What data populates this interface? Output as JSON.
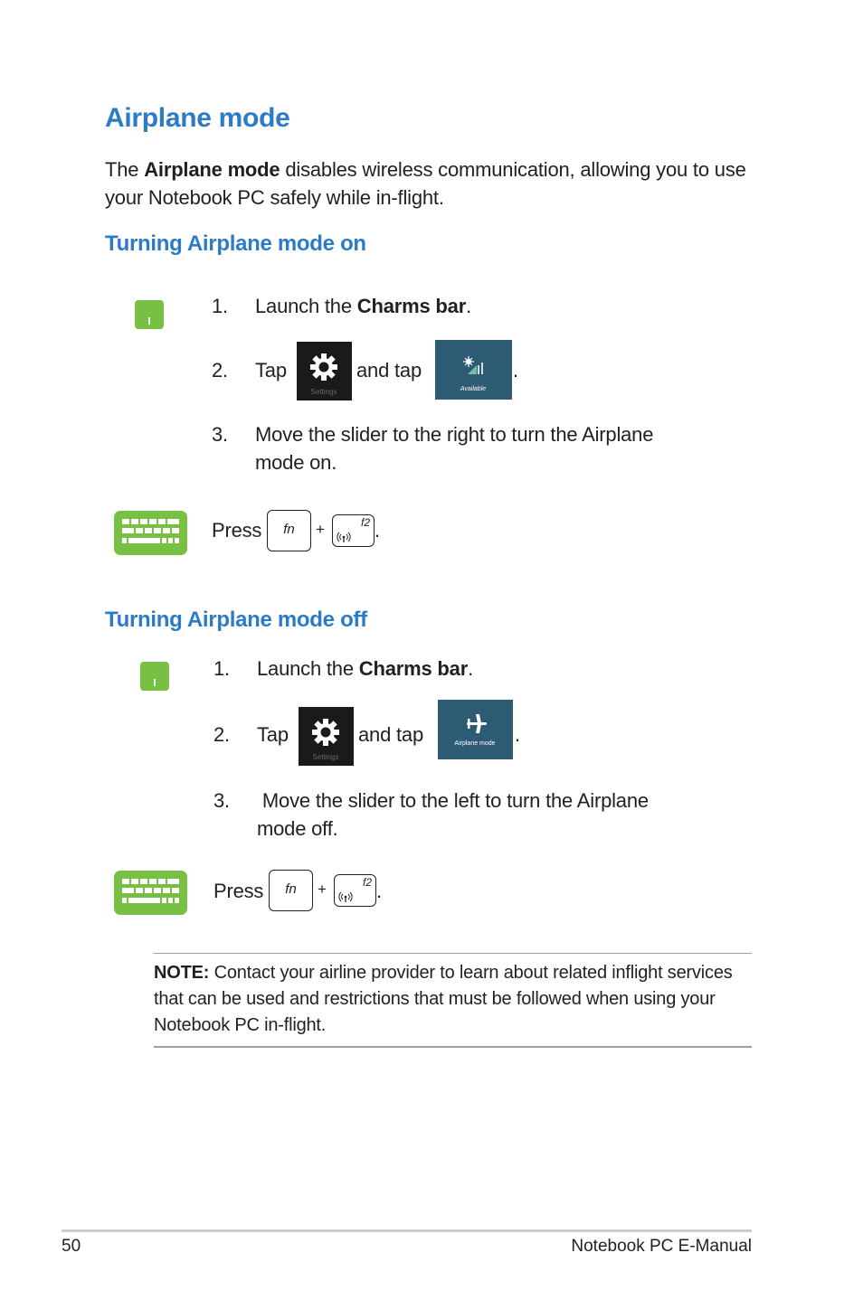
{
  "page": {
    "title": "Airplane mode",
    "intro": {
      "before": "The ",
      "bold": "Airplane mode",
      "after": " disables wireless communication, allowing you to use your Notebook PC safely while in-flight."
    }
  },
  "sections": [
    {
      "heading": "Turning Airplane mode on",
      "touch_steps": [
        {
          "num": "1.",
          "before": "Launch the ",
          "bold": "Charms bar",
          "after": "."
        },
        {
          "num": "2.",
          "tap": "Tap",
          "and_tap": "and tap",
          "end": ".",
          "tile1_label": "Settings",
          "tile1_icon": "gear-icon",
          "tile2_label": "Available",
          "tile2_icon": "wifi-signal-icon"
        },
        {
          "num": "3.",
          "text_line1": "Move the slider to the right to turn the Airplane",
          "text_line2": "mode on."
        }
      ],
      "keyboard": {
        "press": "Press",
        "key1": "fn",
        "plus": "+",
        "key2": "f2",
        "key2_icon": "wireless-icon",
        "end": "."
      }
    },
    {
      "heading": "Turning Airplane mode off",
      "touch_steps": [
        {
          "num": "1.",
          "before": "Launch the ",
          "bold": "Charms bar",
          "after": "."
        },
        {
          "num": "2.",
          "tap": "Tap",
          "and_tap": "and tap",
          "end": ".",
          "tile1_label": "Settings",
          "tile1_icon": "gear-icon",
          "tile2_label": "Airplane mode",
          "tile2_icon": "airplane-icon"
        },
        {
          "num": "3.",
          "text_line1": " Move the slider to the left to turn the Airplane",
          "text_line2": "mode off."
        }
      ],
      "keyboard": {
        "press": "Press",
        "key1": "fn",
        "plus": "+",
        "key2": "f2",
        "key2_icon": "wireless-icon",
        "end": "."
      }
    }
  ],
  "note": {
    "label": "NOTE:",
    "text": " Contact your airline provider to learn about related inflight services that can be used and restrictions that must be followed when using your Notebook PC in-flight."
  },
  "footer": {
    "page_number": "50",
    "manual_title": "Notebook PC E-Manual"
  },
  "colors": {
    "heading": "#2b7bc6",
    "icon_green": "#77c043",
    "tile_dark": "#1a1a1a",
    "tile_blue": "#2d5b73"
  }
}
